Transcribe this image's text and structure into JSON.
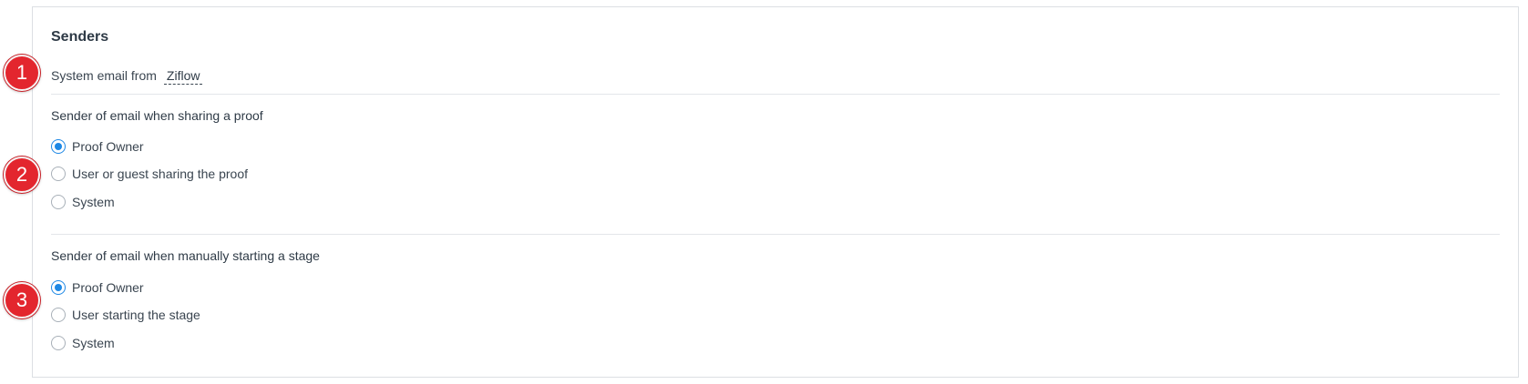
{
  "senders": {
    "title": "Senders",
    "system_email": {
      "label": "System email from",
      "value": "Ziflow"
    },
    "share_proof": {
      "label": "Sender of email when sharing a proof",
      "options": [
        {
          "label": "Proof Owner",
          "checked": true
        },
        {
          "label": "User or guest sharing the proof",
          "checked": false
        },
        {
          "label": "System",
          "checked": false
        }
      ]
    },
    "start_stage": {
      "label": "Sender of email when manually starting a stage",
      "options": [
        {
          "label": "Proof Owner",
          "checked": true
        },
        {
          "label": "User starting the stage",
          "checked": false
        },
        {
          "label": "System",
          "checked": false
        }
      ]
    }
  },
  "annotations": [
    "1",
    "2",
    "3"
  ],
  "colors": {
    "accent": "#1e88e5",
    "badge": "#e3262e"
  }
}
